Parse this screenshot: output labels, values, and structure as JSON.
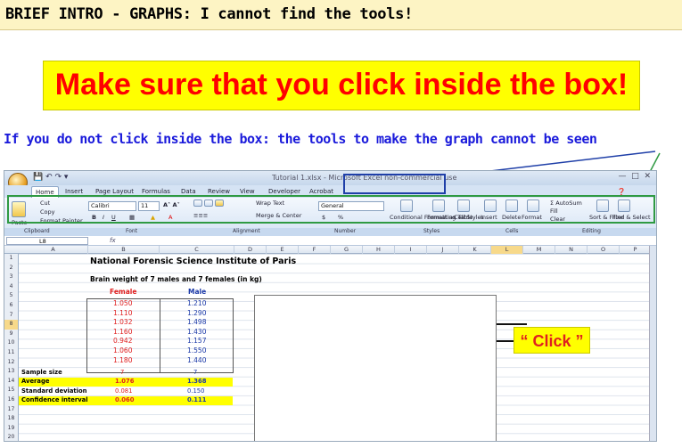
{
  "header": {
    "title": "BRIEF INTRO - GRAPHS: I cannot find the tools!"
  },
  "banner": {
    "text": "Make sure that you click inside the box!"
  },
  "note": {
    "text": "If you do not click inside the box: the tools to make the graph cannot be seen"
  },
  "callout": {
    "text": "“ Click ”"
  },
  "excel": {
    "window_title": "Tutorial 1.xlsx - Microsoft Excel non-commercial use",
    "tabs": [
      "Home",
      "Insert",
      "Page Layout",
      "Formulas",
      "Data",
      "Review",
      "View",
      "Developer",
      "Acrobat"
    ],
    "clipboard": {
      "paste": "Paste",
      "cut": "Cut",
      "copy": "Copy",
      "format_painter": "Format Painter"
    },
    "font": {
      "name": "Calibri",
      "size": "11"
    },
    "alignment": {
      "wrap": "Wrap Text",
      "merge": "Merge & Center"
    },
    "number": {
      "format": "General",
      "currency": "$",
      "percent": "%"
    },
    "styles": {
      "conditional": "Conditional Formatting",
      "format_table": "Format as Table",
      "cell_styles": "Cell Styles"
    },
    "cells": {
      "insert": "Insert",
      "delete": "Delete",
      "format": "Format"
    },
    "editing": {
      "autosum": "AutoSum",
      "fill": "Fill",
      "clear": "Clear",
      "sort": "Sort & Filter",
      "find": "Find & Select"
    },
    "group_labels": [
      "Clipboard",
      "Font",
      "Alignment",
      "Number",
      "Styles",
      "Cells",
      "Editing"
    ],
    "name_box": "L8",
    "fx": "fx",
    "columns": [
      "A",
      "B",
      "C",
      "D",
      "E",
      "F",
      "G",
      "H",
      "I",
      "J",
      "K",
      "L",
      "M",
      "N",
      "O",
      "P"
    ],
    "rows": [
      "1",
      "2",
      "3",
      "4",
      "5",
      "6",
      "7",
      "8",
      "9",
      "10",
      "11",
      "12",
      "13",
      "14",
      "15",
      "16",
      "17",
      "18",
      "19",
      "20"
    ],
    "sheet": {
      "title": "National Forensic Science Institute of Paris",
      "subtitle": "Brain weight of 7 males and 7 females (in kg)",
      "col_female": "Female",
      "col_male": "Male",
      "female": [
        "1.050",
        "1.110",
        "1.032",
        "1.160",
        "0.942",
        "1.060",
        "1.180"
      ],
      "male": [
        "1.210",
        "1.290",
        "1.498",
        "1.430",
        "1.157",
        "1.550",
        "1.440"
      ],
      "stats": [
        {
          "label": "Sample size",
          "female": "7",
          "male": "7"
        },
        {
          "label": "Average",
          "female": "1.076",
          "male": "1.368"
        },
        {
          "label": "Standard deviation",
          "female": "0.081",
          "male": "0.150"
        },
        {
          "label": "Confidence interval",
          "female": "0.060",
          "male": "0.111"
        }
      ]
    }
  },
  "colors": {
    "highlight": "#ffff00",
    "banner_text": "#ff0000",
    "note_text": "#1a1adb",
    "green_box": "#2f9a43",
    "blue_box": "#1f3fa8"
  }
}
